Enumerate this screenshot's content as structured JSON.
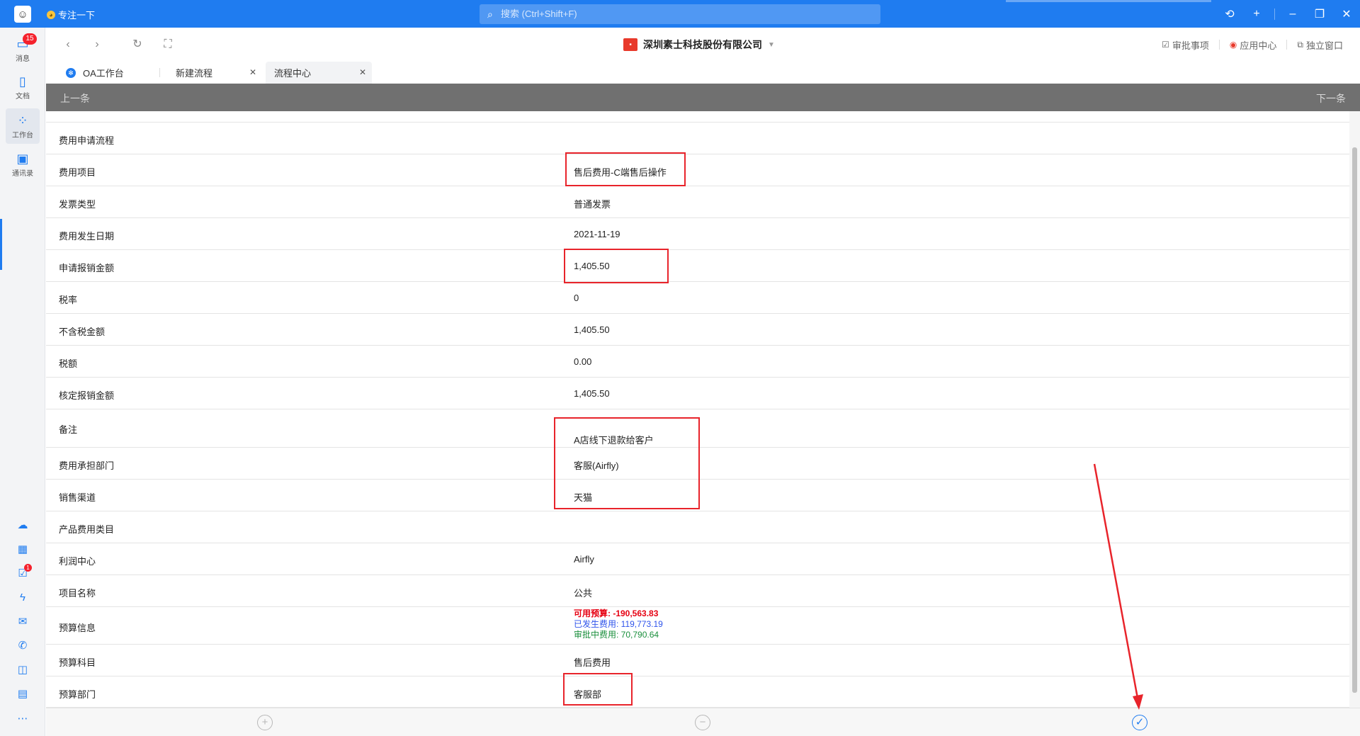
{
  "titlebar": {
    "status": "专注一下",
    "search_placeholder": "搜索 (Ctrl+Shift+F)",
    "brand_color": "#1f7cf0"
  },
  "sidebar": {
    "items": [
      {
        "label": "消息",
        "icon": "chat-icon",
        "badge": "15"
      },
      {
        "label": "文档",
        "icon": "document-icon"
      },
      {
        "label": "工作台",
        "icon": "grid-icon"
      },
      {
        "label": "通讯录",
        "icon": "contacts-icon"
      }
    ],
    "tool_badge": "1"
  },
  "navbar": {
    "company": "深圳素士科技股份有限公司",
    "links": {
      "approval": "审批事项",
      "apps": "应用中心",
      "window": "独立窗口"
    }
  },
  "tabs": [
    {
      "label": "OA工作台"
    },
    {
      "label": "新建流程"
    },
    {
      "label": "流程中心"
    }
  ],
  "pager": {
    "prev": "上一条",
    "next": "下一条"
  },
  "form": {
    "rows": [
      {
        "label": "费用申请流程",
        "value": ""
      },
      {
        "label": "费用项目",
        "value": "售后费用-C端售后操作"
      },
      {
        "label": "发票类型",
        "value": "普通发票"
      },
      {
        "label": "费用发生日期",
        "value": "2021-11-19"
      },
      {
        "label": "申请报销金额",
        "value": "1,405.50"
      },
      {
        "label": "税率",
        "value": "0"
      },
      {
        "label": "不含税金额",
        "value": "1,405.50"
      },
      {
        "label": "税额",
        "value": "0.00"
      },
      {
        "label": "核定报销金额",
        "value": "1,405.50"
      },
      {
        "label": "备注",
        "value": "A店线下退款给客户"
      },
      {
        "label": "费用承担部门",
        "value": "客服(Airfly)"
      },
      {
        "label": "销售渠道",
        "value": "天猫"
      },
      {
        "label": "产品费用类目",
        "value": ""
      },
      {
        "label": "利润中心",
        "value": "Airfly"
      },
      {
        "label": "项目名称",
        "value": "公共"
      },
      {
        "label": "预算信息",
        "value": ""
      },
      {
        "label": "预算科目",
        "value": "售后费用"
      },
      {
        "label": "预算部门",
        "value": "客服部"
      }
    ],
    "budget": {
      "available": "可用预算:  -190,563.83",
      "spent": "已发生费用:  119,773.19",
      "pending": "审批中费用:  70,790.64"
    }
  },
  "colors": {
    "highlight": "#e8242b",
    "budget_red": "#e60012",
    "budget_blue": "#2f54eb",
    "budget_green": "#1a8f3c"
  }
}
